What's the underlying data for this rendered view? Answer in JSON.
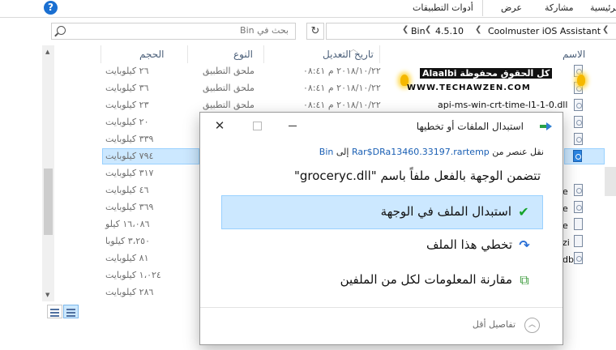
{
  "ribbon": {
    "help_icon": "?",
    "tabs": [
      "أدوات التطبيقات",
      "عرض",
      "مشاركة",
      "الرئيسية"
    ]
  },
  "address": {
    "search_placeholder": "بحث في Bin",
    "refresh_icon": "↻",
    "dropdown_icon": "❮❮",
    "crumbs": [
      "Bin",
      "4.5.10",
      "Coolmuster iOS Assistant"
    ],
    "crumb_sep": "❮"
  },
  "columns": {
    "size": "الحجم",
    "type": "النوع",
    "date": "تاريخ التعديل",
    "name": "الاسم"
  },
  "rows": [
    {
      "size": "٢٦ كيلوبايت",
      "type": "ملحق التطبيق",
      "date": "٢٠١٨/١٠/٢٢ م ٠٨:٤١",
      "name": "",
      "icon": "dll"
    },
    {
      "size": "٣٦ كيلوبايت",
      "type": "ملحق التطبيق",
      "date": "٢٠١٨/١٠/٢٢ م ٠٨:٤١",
      "name": "",
      "icon": "dll"
    },
    {
      "size": "٢٣ كيلوبايت",
      "type": "ملحق التطبيق",
      "date": "٢٠١٨/١٠/٢٢ م ٠٨:٤١",
      "name": "api-ms-win-crt-time-l1-1-0.dll",
      "icon": "dll"
    },
    {
      "size": "٢٠ كيلوبايت",
      "type": "",
      "date": "",
      "name": "",
      "icon": "dll"
    },
    {
      "size": "٣٣٩ كيلوبايت",
      "type": "",
      "date": "",
      "name": "",
      "icon": "dll"
    },
    {
      "size": "٧٩٤ كيلوبايت",
      "type": "",
      "date": "",
      "name": "",
      "icon": "app",
      "selected": true
    },
    {
      "size": "٣١٧ كيلوبايت",
      "type": "",
      "date": "",
      "name": "e",
      "icon": "dll"
    },
    {
      "size": "٤٦ كيلوبايت",
      "type": "",
      "date": "",
      "name": "e",
      "icon": "dll"
    },
    {
      "size": "٣٦٩ كيلوبايت",
      "type": "",
      "date": "",
      "name": "e",
      "icon": "dll"
    },
    {
      "size": "١٦،٠٨٦ كيلو",
      "type": "",
      "date": "",
      "name": "zi",
      "icon": "plain"
    },
    {
      "size": "٣،٢٥٠ كيلوبا",
      "type": "",
      "date": "",
      "name": "db",
      "icon": "plain"
    },
    {
      "size": "٨١ كيلوبايت",
      "type": "",
      "date": "",
      "name": "",
      "icon": "dll"
    },
    {
      "size": "١،٠٢٤ كيلوبايت",
      "type": "",
      "date": "",
      "name": "",
      "icon": "dll"
    },
    {
      "size": "٢٨٦ كيلوبايت",
      "type": "",
      "date": "",
      "name": "",
      "icon": "dll"
    }
  ],
  "watermark": {
    "line1": "كل الحقوق محفوظة Alaalbi",
    "line2": "WWW.TECHAWZEN.COM"
  },
  "dialog": {
    "title": "استبدال الملفات أو تخطيها",
    "close_icon": "✕",
    "copy_prefix": "نقل عنصر من",
    "source": "Rar$DRa13460.33197.rartemp",
    "to_word": "إلى",
    "dest": "Bin",
    "message": "تتضمن الوجهة بالفعل ملفاً باسم \"groceryc.dll\"",
    "options": [
      {
        "label": "استبدال الملف في الوجهة",
        "icon": "✔"
      },
      {
        "label": "تخطي هذا الملف",
        "icon": "↷"
      },
      {
        "label": "مقارنة المعلومات لكل من الملفين",
        "icon": "⧉"
      }
    ],
    "footer_label": "تفاصيل أقل",
    "footer_icon": "︿"
  },
  "colors": {
    "selection": "#cce8ff",
    "selection_border": "#99d1ff",
    "link": "#1a5fb4",
    "help": "#1a6fd1"
  }
}
